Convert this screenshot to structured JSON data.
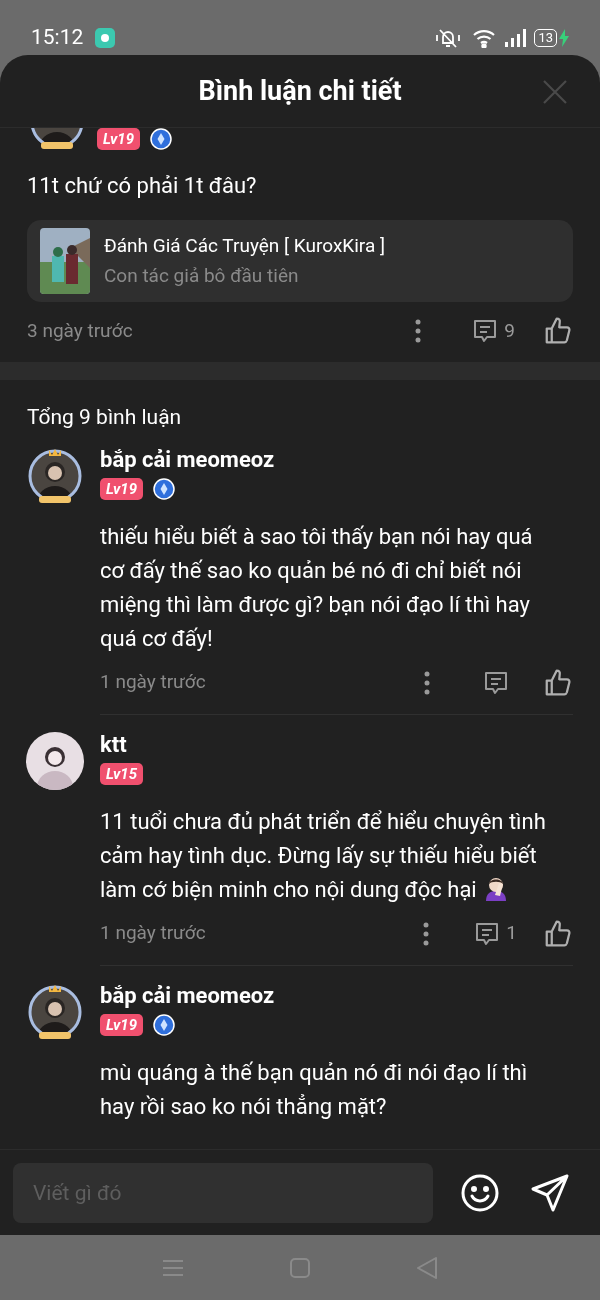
{
  "status_bar": {
    "time": "15:12",
    "battery": "13"
  },
  "header": {
    "title": "Bình luận chi tiết"
  },
  "main_comment": {
    "level_badge": "Lv19",
    "verified": true,
    "text": "11t chứ có phải 1t đâu?",
    "story": {
      "title": "Đánh Giá Các Truyện [ KuroxKira ]",
      "subtitle": "Con tác giả bô đầu tiên"
    },
    "time": "3 ngày trước",
    "reply_count": "9"
  },
  "total": "Tổng 9 bình luận",
  "comments": [
    {
      "name": "bắp cải meomeoz",
      "level_badge": "Lv19",
      "verified": true,
      "frame": true,
      "text": "thiếu hiểu biết à sao tôi thấy bạn nói hay quá cơ đấy thế sao ko quản bé nó đi chỉ biết nói miệng thì làm được gì? bạn nói đạo lí thì hay quá cơ đấy!",
      "emoji": false,
      "time": "1 ngày trước"
    },
    {
      "name": "ktt",
      "level_badge": "Lv15",
      "verified": false,
      "frame": false,
      "text": "11 tuổi chưa đủ phát triển để hiểu chuyện tình cảm hay tình dục. Đừng lấy sự thiếu hiểu biết làm cớ biện minh cho nội dung độc hại",
      "emoji": true,
      "time": "1 ngày trước",
      "reply_count": "1"
    },
    {
      "name": "bắp cải meomeoz",
      "level_badge": "Lv19",
      "verified": true,
      "frame": true,
      "text": "mù quáng à thế bạn quản nó đi nói đạo lí thì hay rồi sao ko nói thẳng mặt?",
      "emoji": false
    }
  ],
  "composer": {
    "placeholder": "Viết gì đó"
  }
}
